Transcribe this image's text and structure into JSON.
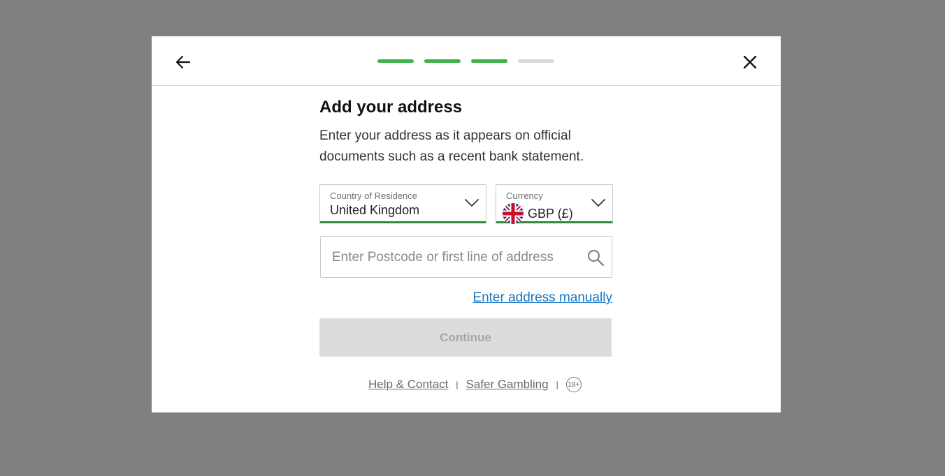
{
  "header": {
    "progress": {
      "total_steps": 4,
      "completed_steps": 3
    }
  },
  "content": {
    "title": "Add your address",
    "subtitle": "Enter your address as it appears on official documents such as a recent bank statement."
  },
  "country_select": {
    "label": "Country of Residence",
    "value": "United Kingdom"
  },
  "currency_select": {
    "label": "Currency",
    "value": "GBP (£)"
  },
  "address_search": {
    "placeholder": "Enter Postcode or first line of address",
    "value": ""
  },
  "manual_link": "Enter address manually",
  "continue_button": {
    "label": "Continue",
    "disabled": true
  },
  "footer": {
    "help_link": "Help & Contact",
    "separator": "|",
    "safer_gambling_link": "Safer Gambling",
    "age_badge": "18+"
  },
  "colors": {
    "overlay": "#808080",
    "progress_done": "#3db249",
    "progress_todo": "#d9d9d9",
    "field_underline": "#2e8b3e",
    "link": "#1a78c2",
    "button_disabled_bg": "#dcdcdc",
    "button_disabled_text": "#a6a6a6"
  },
  "icons": {
    "back": "arrow-left-icon",
    "close": "close-icon",
    "chevron": "chevron-down-icon",
    "search": "search-icon",
    "flag": "uk-flag-icon"
  }
}
